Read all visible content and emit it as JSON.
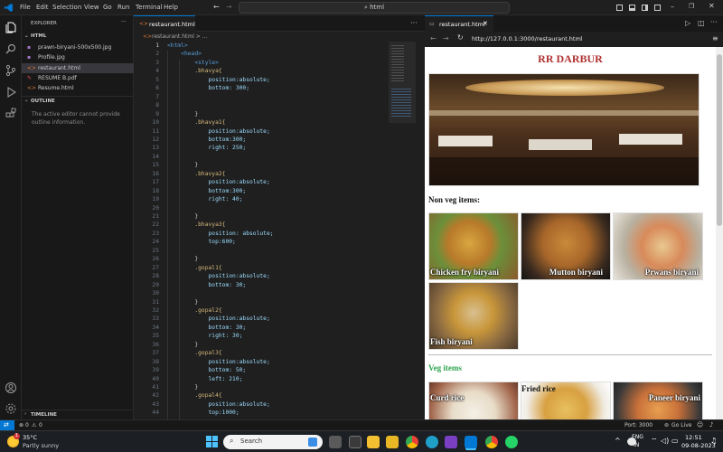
{
  "menu": [
    "File",
    "Edit",
    "Selection",
    "View",
    "Go",
    "Run",
    "Terminal",
    "Help"
  ],
  "search": {
    "label": "html"
  },
  "explorer": {
    "title": "EXPLORER",
    "folder": "HTML",
    "files": [
      "prawn-biryani-500x500.jpg",
      "Profile.jpg",
      "restaurant.html",
      "RESUME B.pdf",
      "Resume.html"
    ],
    "outline_title": "OUTLINE",
    "outline_msg_1": "The active editor cannot provide",
    "outline_msg_2": "outline information.",
    "timeline_title": "TIMELINE"
  },
  "editor": {
    "tab": "restaurant.html",
    "breadcrumb": "restaurant.html > ..."
  },
  "code": [
    {
      "n": "1",
      "t": "<html>",
      "c": "tag"
    },
    {
      "n": "2",
      "t": "    <head>",
      "c": "tag"
    },
    {
      "n": "3",
      "t": "        <style>",
      "c": "tag"
    },
    {
      "n": "4",
      "t": "        .bhavya{",
      "c": "sel"
    },
    {
      "n": "5",
      "t": "            position:absolute;",
      "c": "prop"
    },
    {
      "n": "6",
      "t": "            bottom: 300;",
      "c": "prop"
    },
    {
      "n": "7",
      "t": "",
      "c": "txt"
    },
    {
      "n": "8",
      "t": "",
      "c": "txt"
    },
    {
      "n": "9",
      "t": "        }",
      "c": "txt"
    },
    {
      "n": "10",
      "t": "        .bhavya1{",
      "c": "sel"
    },
    {
      "n": "11",
      "t": "            position:absolute;",
      "c": "prop"
    },
    {
      "n": "12",
      "t": "            bottom:300;",
      "c": "prop"
    },
    {
      "n": "13",
      "t": "            right: 250;",
      "c": "prop"
    },
    {
      "n": "14",
      "t": "",
      "c": "txt"
    },
    {
      "n": "15",
      "t": "        }",
      "c": "txt"
    },
    {
      "n": "16",
      "t": "        .bhavya2{",
      "c": "sel"
    },
    {
      "n": "17",
      "t": "            position:absolute;",
      "c": "prop"
    },
    {
      "n": "18",
      "t": "            bottom:300;",
      "c": "prop"
    },
    {
      "n": "19",
      "t": "            right: 40;",
      "c": "prop"
    },
    {
      "n": "20",
      "t": "",
      "c": "txt"
    },
    {
      "n": "21",
      "t": "        }",
      "c": "txt"
    },
    {
      "n": "22",
      "t": "        .bhavya3{",
      "c": "sel"
    },
    {
      "n": "23",
      "t": "            position: absolute;",
      "c": "prop"
    },
    {
      "n": "24",
      "t": "            top:600;",
      "c": "prop"
    },
    {
      "n": "25",
      "t": "",
      "c": "txt"
    },
    {
      "n": "26",
      "t": "        }",
      "c": "txt"
    },
    {
      "n": "27",
      "t": "        .gopal1{",
      "c": "sel"
    },
    {
      "n": "28",
      "t": "            position:absolute;",
      "c": "prop"
    },
    {
      "n": "29",
      "t": "            bottom: 30;",
      "c": "prop"
    },
    {
      "n": "30",
      "t": "",
      "c": "txt"
    },
    {
      "n": "31",
      "t": "        }",
      "c": "txt"
    },
    {
      "n": "32",
      "t": "        .gopal2{",
      "c": "sel"
    },
    {
      "n": "33",
      "t": "            position:absolute;",
      "c": "prop"
    },
    {
      "n": "34",
      "t": "            bottom: 30;",
      "c": "prop"
    },
    {
      "n": "35",
      "t": "            right: 30;",
      "c": "prop"
    },
    {
      "n": "36",
      "t": "        }",
      "c": "txt"
    },
    {
      "n": "37",
      "t": "        .gopal3{",
      "c": "sel"
    },
    {
      "n": "38",
      "t": "            position:absolute;",
      "c": "prop"
    },
    {
      "n": "39",
      "t": "            bottom: 50;",
      "c": "prop"
    },
    {
      "n": "40",
      "t": "            left: 210;",
      "c": "prop"
    },
    {
      "n": "41",
      "t": "        }",
      "c": "txt"
    },
    {
      "n": "42",
      "t": "        .gopal4{",
      "c": "sel"
    },
    {
      "n": "43",
      "t": "            position:absolute;",
      "c": "prop"
    },
    {
      "n": "44",
      "t": "            top:1000;",
      "c": "prop"
    }
  ],
  "browser": {
    "tab": "restaurant.html",
    "url": "http://127.0.0.1:3000/restaurant.html"
  },
  "page": {
    "title": "RR DARBUR",
    "nonveg_heading": "Non veg items:",
    "nonveg": [
      "Chicken fry biryani",
      "Mutton biryani",
      "Prwans biryani",
      "Fish biryani"
    ],
    "veg_heading": "Veg items",
    "veg": [
      "Curd rice",
      "Fried rice",
      "Paneer biryani"
    ]
  },
  "status": {
    "errors": "0",
    "warnings": "0",
    "port": "Port: 3000",
    "golive": "Go Live"
  },
  "taskbar": {
    "temp": "35°C",
    "weather": "Partly sunny",
    "search": "Search",
    "lang1": "ENG",
    "lang2": "IN",
    "time": "12:51",
    "date": "09-08-2023",
    "badge": "1"
  },
  "colors": {
    "tag": "#569cd6",
    "sel": "#d7ba7d",
    "prop": "#9cdcfe",
    "txt": "#cccccc",
    "title": "#c0392b",
    "veg": "#2ea44f"
  }
}
